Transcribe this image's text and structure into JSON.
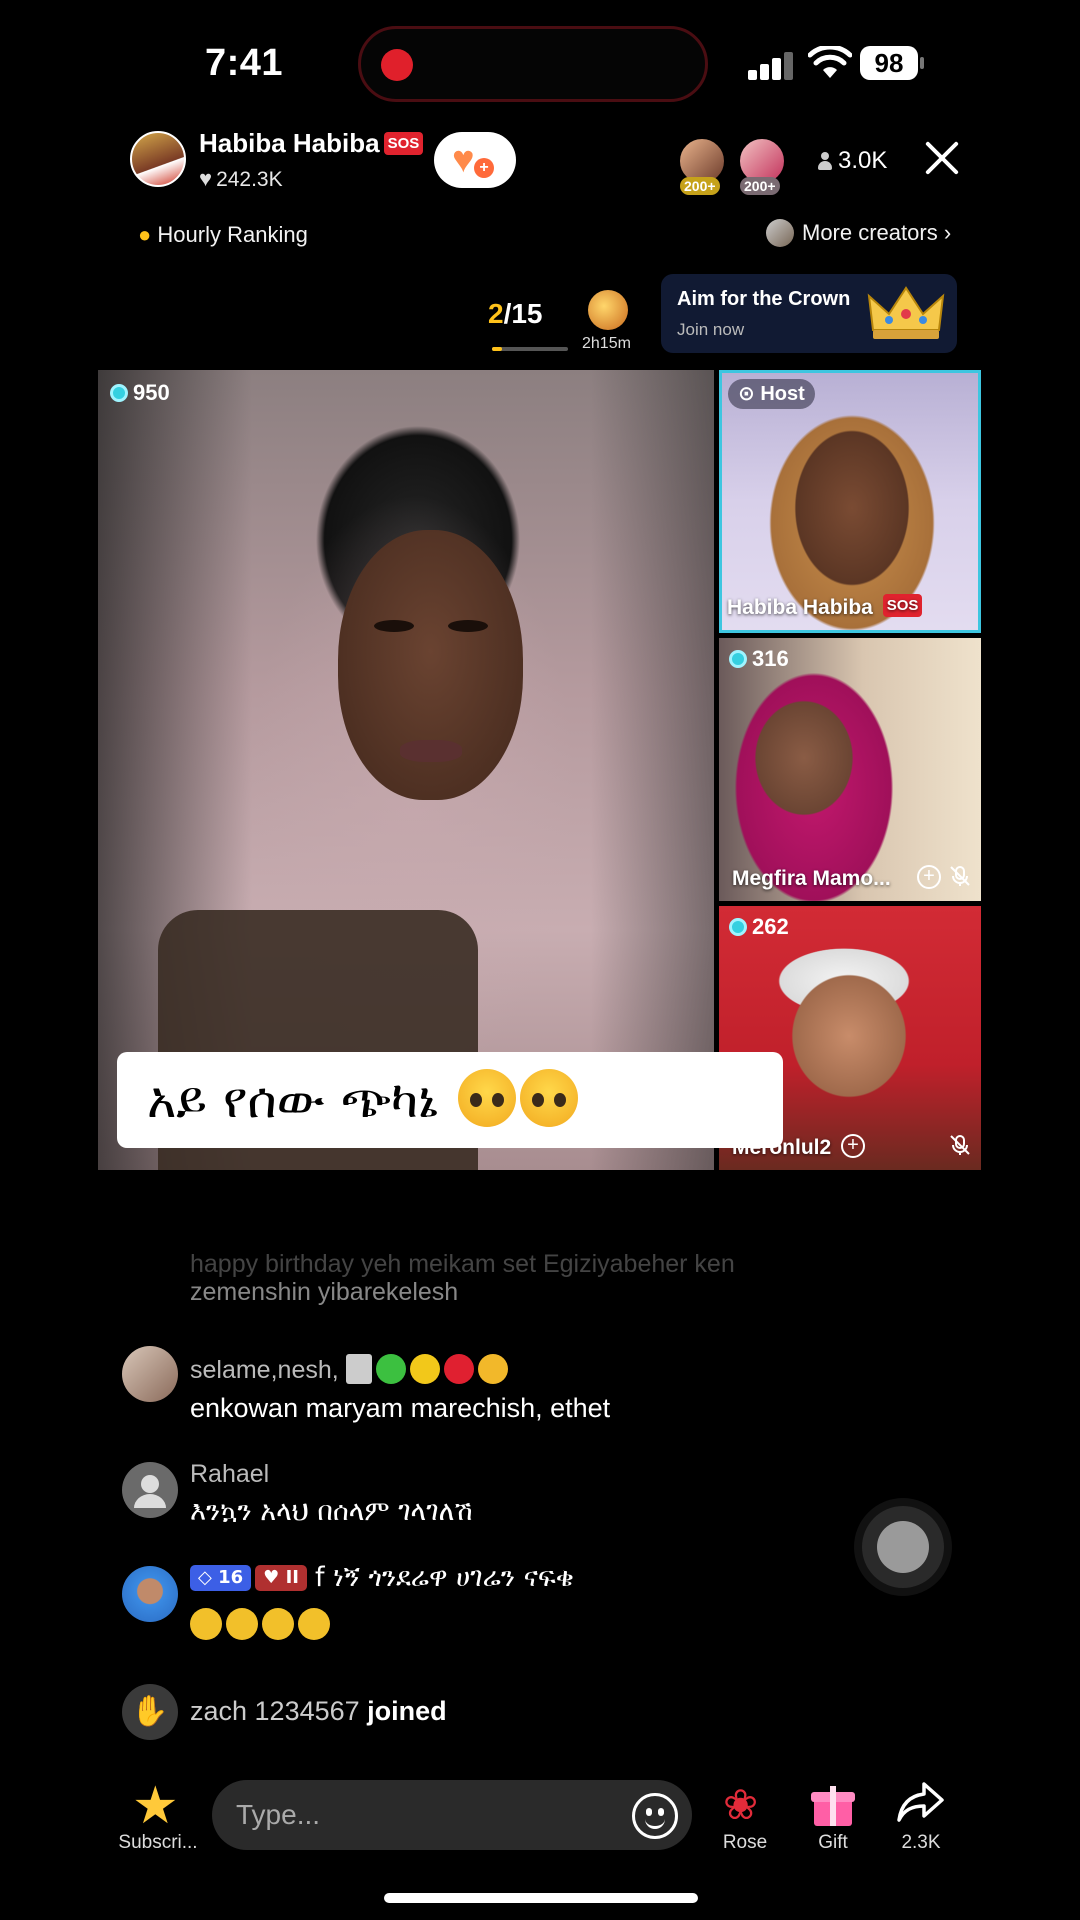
{
  "status_bar": {
    "time": "7:41",
    "battery": "98"
  },
  "header": {
    "host_name": "Habiba Habiba",
    "sos_badge": "SOS",
    "likes": "242.3K",
    "viewer_badges": [
      "200+",
      "200+"
    ],
    "viewer_count": "3.0K",
    "ranking_label": "Hourly Ranking",
    "more_creators_label": "More creators"
  },
  "ranking": {
    "current": "2",
    "total": "/15",
    "timer": "2h15m",
    "progress": 0.13
  },
  "promo": {
    "title": "Aim for the Crown",
    "subtitle": "Join now"
  },
  "video_grid": {
    "main": {
      "score": "950"
    },
    "caption": "አይ የሰው ጭካኔ",
    "host_tile": {
      "tag": "Host",
      "name": "Habiba Habiba"
    },
    "guests": [
      {
        "score": "316",
        "name": "Megfira Mamo..."
      },
      {
        "score": "262",
        "name": "Meronlul2"
      }
    ]
  },
  "chat": {
    "faded_line1": "happy  birthday  yeh meikam  set Egiziyabeher ken",
    "faded_line2": "zemenshin yibarekelesh",
    "messages": [
      {
        "name": "selame,nesh,",
        "text": "enkowan maryam marechish, ethet"
      },
      {
        "name": "Rahael",
        "text": "እንኳን አላህ በሰላም ገላገለሽ"
      },
      {
        "level": "16",
        "fan_badge": "II",
        "text": "f ነኝ ጎንደሬዋ ሀገሬን ናፍቄ"
      }
    ],
    "joined_user": "zach 1234567",
    "joined_label": "joined"
  },
  "bottom_bar": {
    "subscribe_label": "Subscri...",
    "input_placeholder": "Type...",
    "rose_label": "Rose",
    "gift_label": "Gift",
    "share_count": "2.3K"
  },
  "colors": {
    "accent_yellow": "#ffc21a",
    "host_border": "#3ec6e0",
    "sos_red": "#e0232e"
  }
}
